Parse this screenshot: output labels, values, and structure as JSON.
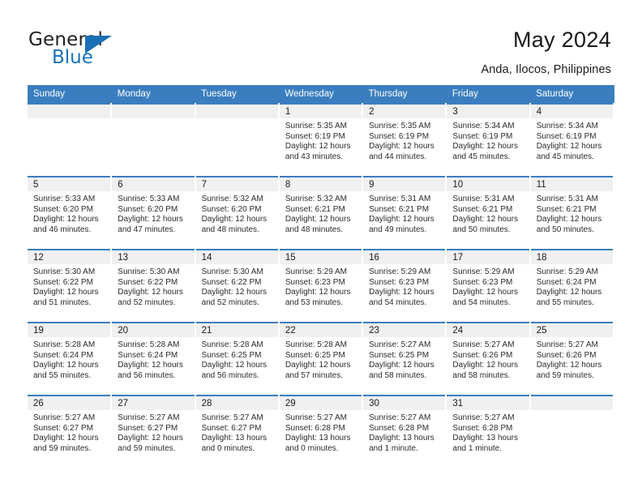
{
  "brand": {
    "name_top": "General",
    "name_bottom": "Blue",
    "accent_color": "#1a6fb5"
  },
  "header": {
    "title": "May 2024",
    "location": "Anda, Ilocos, Philippines"
  },
  "theme": {
    "header_row_color": "#3a7ebf",
    "daynum_strip_color": "#f0f0f0",
    "cell_background": "#ffffff",
    "text_color": "#1a1a1a"
  },
  "weekdays": [
    "Sunday",
    "Monday",
    "Tuesday",
    "Wednesday",
    "Thursday",
    "Friday",
    "Saturday"
  ],
  "labels": {
    "sunrise_prefix": "Sunrise:",
    "sunset_prefix": "Sunset:",
    "daylight_prefix": "Daylight:"
  },
  "weeks": [
    [
      {
        "day": "",
        "empty": true
      },
      {
        "day": "",
        "empty": true
      },
      {
        "day": "",
        "empty": true
      },
      {
        "day": "1",
        "sunrise": "Sunrise: 5:35 AM",
        "sunset": "Sunset: 6:19 PM",
        "daylight_line1": "Daylight: 12 hours",
        "daylight_line2": "and 43 minutes."
      },
      {
        "day": "2",
        "sunrise": "Sunrise: 5:35 AM",
        "sunset": "Sunset: 6:19 PM",
        "daylight_line1": "Daylight: 12 hours",
        "daylight_line2": "and 44 minutes."
      },
      {
        "day": "3",
        "sunrise": "Sunrise: 5:34 AM",
        "sunset": "Sunset: 6:19 PM",
        "daylight_line1": "Daylight: 12 hours",
        "daylight_line2": "and 45 minutes."
      },
      {
        "day": "4",
        "sunrise": "Sunrise: 5:34 AM",
        "sunset": "Sunset: 6:19 PM",
        "daylight_line1": "Daylight: 12 hours",
        "daylight_line2": "and 45 minutes."
      }
    ],
    [
      {
        "day": "5",
        "sunrise": "Sunrise: 5:33 AM",
        "sunset": "Sunset: 6:20 PM",
        "daylight_line1": "Daylight: 12 hours",
        "daylight_line2": "and 46 minutes."
      },
      {
        "day": "6",
        "sunrise": "Sunrise: 5:33 AM",
        "sunset": "Sunset: 6:20 PM",
        "daylight_line1": "Daylight: 12 hours",
        "daylight_line2": "and 47 minutes."
      },
      {
        "day": "7",
        "sunrise": "Sunrise: 5:32 AM",
        "sunset": "Sunset: 6:20 PM",
        "daylight_line1": "Daylight: 12 hours",
        "daylight_line2": "and 48 minutes."
      },
      {
        "day": "8",
        "sunrise": "Sunrise: 5:32 AM",
        "sunset": "Sunset: 6:21 PM",
        "daylight_line1": "Daylight: 12 hours",
        "daylight_line2": "and 48 minutes."
      },
      {
        "day": "9",
        "sunrise": "Sunrise: 5:31 AM",
        "sunset": "Sunset: 6:21 PM",
        "daylight_line1": "Daylight: 12 hours",
        "daylight_line2": "and 49 minutes."
      },
      {
        "day": "10",
        "sunrise": "Sunrise: 5:31 AM",
        "sunset": "Sunset: 6:21 PM",
        "daylight_line1": "Daylight: 12 hours",
        "daylight_line2": "and 50 minutes."
      },
      {
        "day": "11",
        "sunrise": "Sunrise: 5:31 AM",
        "sunset": "Sunset: 6:21 PM",
        "daylight_line1": "Daylight: 12 hours",
        "daylight_line2": "and 50 minutes."
      }
    ],
    [
      {
        "day": "12",
        "sunrise": "Sunrise: 5:30 AM",
        "sunset": "Sunset: 6:22 PM",
        "daylight_line1": "Daylight: 12 hours",
        "daylight_line2": "and 51 minutes."
      },
      {
        "day": "13",
        "sunrise": "Sunrise: 5:30 AM",
        "sunset": "Sunset: 6:22 PM",
        "daylight_line1": "Daylight: 12 hours",
        "daylight_line2": "and 52 minutes."
      },
      {
        "day": "14",
        "sunrise": "Sunrise: 5:30 AM",
        "sunset": "Sunset: 6:22 PM",
        "daylight_line1": "Daylight: 12 hours",
        "daylight_line2": "and 52 minutes."
      },
      {
        "day": "15",
        "sunrise": "Sunrise: 5:29 AM",
        "sunset": "Sunset: 6:23 PM",
        "daylight_line1": "Daylight: 12 hours",
        "daylight_line2": "and 53 minutes."
      },
      {
        "day": "16",
        "sunrise": "Sunrise: 5:29 AM",
        "sunset": "Sunset: 6:23 PM",
        "daylight_line1": "Daylight: 12 hours",
        "daylight_line2": "and 54 minutes."
      },
      {
        "day": "17",
        "sunrise": "Sunrise: 5:29 AM",
        "sunset": "Sunset: 6:23 PM",
        "daylight_line1": "Daylight: 12 hours",
        "daylight_line2": "and 54 minutes."
      },
      {
        "day": "18",
        "sunrise": "Sunrise: 5:29 AM",
        "sunset": "Sunset: 6:24 PM",
        "daylight_line1": "Daylight: 12 hours",
        "daylight_line2": "and 55 minutes."
      }
    ],
    [
      {
        "day": "19",
        "sunrise": "Sunrise: 5:28 AM",
        "sunset": "Sunset: 6:24 PM",
        "daylight_line1": "Daylight: 12 hours",
        "daylight_line2": "and 55 minutes."
      },
      {
        "day": "20",
        "sunrise": "Sunrise: 5:28 AM",
        "sunset": "Sunset: 6:24 PM",
        "daylight_line1": "Daylight: 12 hours",
        "daylight_line2": "and 56 minutes."
      },
      {
        "day": "21",
        "sunrise": "Sunrise: 5:28 AM",
        "sunset": "Sunset: 6:25 PM",
        "daylight_line1": "Daylight: 12 hours",
        "daylight_line2": "and 56 minutes."
      },
      {
        "day": "22",
        "sunrise": "Sunrise: 5:28 AM",
        "sunset": "Sunset: 6:25 PM",
        "daylight_line1": "Daylight: 12 hours",
        "daylight_line2": "and 57 minutes."
      },
      {
        "day": "23",
        "sunrise": "Sunrise: 5:27 AM",
        "sunset": "Sunset: 6:25 PM",
        "daylight_line1": "Daylight: 12 hours",
        "daylight_line2": "and 58 minutes."
      },
      {
        "day": "24",
        "sunrise": "Sunrise: 5:27 AM",
        "sunset": "Sunset: 6:26 PM",
        "daylight_line1": "Daylight: 12 hours",
        "daylight_line2": "and 58 minutes."
      },
      {
        "day": "25",
        "sunrise": "Sunrise: 5:27 AM",
        "sunset": "Sunset: 6:26 PM",
        "daylight_line1": "Daylight: 12 hours",
        "daylight_line2": "and 59 minutes."
      }
    ],
    [
      {
        "day": "26",
        "sunrise": "Sunrise: 5:27 AM",
        "sunset": "Sunset: 6:27 PM",
        "daylight_line1": "Daylight: 12 hours",
        "daylight_line2": "and 59 minutes."
      },
      {
        "day": "27",
        "sunrise": "Sunrise: 5:27 AM",
        "sunset": "Sunset: 6:27 PM",
        "daylight_line1": "Daylight: 12 hours",
        "daylight_line2": "and 59 minutes."
      },
      {
        "day": "28",
        "sunrise": "Sunrise: 5:27 AM",
        "sunset": "Sunset: 6:27 PM",
        "daylight_line1": "Daylight: 13 hours",
        "daylight_line2": "and 0 minutes."
      },
      {
        "day": "29",
        "sunrise": "Sunrise: 5:27 AM",
        "sunset": "Sunset: 6:28 PM",
        "daylight_line1": "Daylight: 13 hours",
        "daylight_line2": "and 0 minutes."
      },
      {
        "day": "30",
        "sunrise": "Sunrise: 5:27 AM",
        "sunset": "Sunset: 6:28 PM",
        "daylight_line1": "Daylight: 13 hours",
        "daylight_line2": "and 1 minute."
      },
      {
        "day": "31",
        "sunrise": "Sunrise: 5:27 AM",
        "sunset": "Sunset: 6:28 PM",
        "daylight_line1": "Daylight: 13 hours",
        "daylight_line2": "and 1 minute."
      },
      {
        "day": "",
        "empty": true
      }
    ]
  ]
}
